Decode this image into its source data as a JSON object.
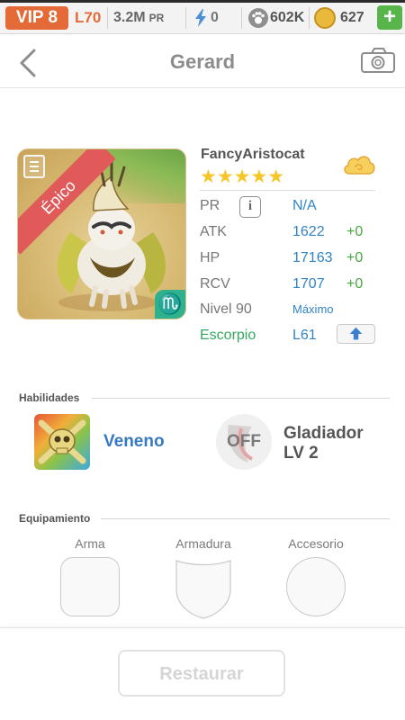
{
  "status_bar": {
    "vip": "VIP 8",
    "level": "L70",
    "power": "3.2M",
    "power_unit": "PR",
    "energy": "0",
    "paws": "602K",
    "coins": "627",
    "add_label": "+"
  },
  "header": {
    "title": "Gerard",
    "back_icon": "chevron-left-icon",
    "camera_icon": "camera-icon"
  },
  "pet": {
    "rarity": "Épico",
    "name": "FancyAristocat",
    "stars": "★★★★★",
    "star_count": 5,
    "element_icon": "cloud-icon",
    "zodiac_symbol": "♏",
    "stats": [
      {
        "label": "PR",
        "value": "N/A",
        "bonus": ""
      },
      {
        "label": "ATK",
        "value": "1622",
        "bonus": "+0"
      },
      {
        "label": "HP",
        "value": "17163",
        "bonus": "+0"
      },
      {
        "label": "RCV",
        "value": "1707",
        "bonus": "+0"
      }
    ],
    "info_label": "i",
    "level_label": "Nivel 90",
    "level_max": "Máximo",
    "zodiac_label": "Escorpio",
    "zodiac_level": "L61"
  },
  "abilities": {
    "title": "Habilidades",
    "skill1": "Veneno",
    "skill2_state": "OFF",
    "skill2_name_line1": "Gladiador",
    "skill2_name_line2": "LV 2"
  },
  "equipment": {
    "title": "Equipamiento",
    "slots": [
      "Arma",
      "Armadura",
      "Accesorio"
    ]
  },
  "actions": {
    "restore": "Restaurar"
  },
  "colors": {
    "accent_orange": "#e46a38",
    "stat_blue": "#2f83c6",
    "bonus_green": "#4aa641",
    "rarity_red": "#e05a5a",
    "zodiac_teal": "#2fb18e"
  }
}
